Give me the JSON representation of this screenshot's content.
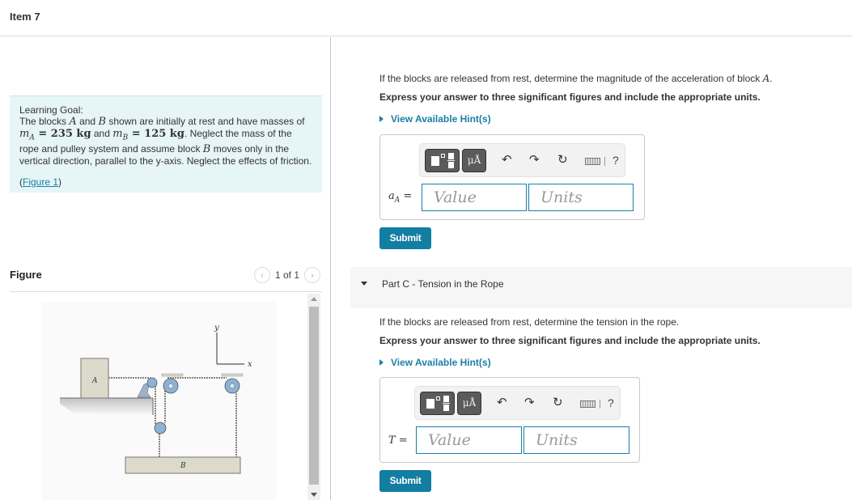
{
  "header": {
    "title": "Item 7"
  },
  "learning_goal": {
    "title": "Learning Goal:",
    "text_1": "The blocks ",
    "sym_A": "A",
    "text_2": " and ",
    "sym_B": "B",
    "text_3": " shown are initially at rest and have masses of ",
    "mA_lhs": "m",
    "mA_sub": "A",
    "mA_rhs": " = 235 kg",
    "text_4": " and ",
    "mB_lhs": "m",
    "mB_sub": "B",
    "mB_rhs": " = 125 kg",
    "text_5": ". Neglect the mass of the rope and pulley system and assume block ",
    "sym_B2": "B",
    "text_6": " moves only in the vertical direction, parallel to the y-axis. Neglect the effects of friction.",
    "figure_link_open": "(",
    "figure_link": "Figure 1",
    "figure_link_close": ")"
  },
  "figure": {
    "label": "Figure",
    "pager": "1 of 1",
    "prev_icon": "chevron-left-icon",
    "next_icon": "chevron-right-icon",
    "labels": {
      "block_a": "A",
      "block_b": "B",
      "axis_x": "x",
      "axis_y": "y"
    }
  },
  "part_b": {
    "question_prefix": "If the blocks are released from rest, determine the magnitude of the acceleration of block ",
    "question_sym": "A",
    "question_suffix": ".",
    "instruction": "Express your answer to three significant figures and include the appropriate units.",
    "hint": "View Available Hint(s)",
    "variable": "a",
    "variable_sub": "A",
    "equals": " =",
    "value_placeholder": "Value",
    "units_placeholder": "Units",
    "unit_button": "μÅ",
    "submit": "Submit"
  },
  "part_c": {
    "header": "Part C - Tension in the Rope",
    "question": "If the blocks are released from rest, determine the tension in the rope.",
    "instruction": "Express your answer to three significant figures and include the appropriate units.",
    "hint": "View Available Hint(s)",
    "variable": "T",
    "equals": " =",
    "value_placeholder": "Value",
    "units_placeholder": "Units",
    "unit_button": "μÅ",
    "submit": "Submit"
  },
  "toolbar_icons": {
    "undo": "↶",
    "redo": "↷",
    "reset": "↻",
    "help": "?"
  }
}
